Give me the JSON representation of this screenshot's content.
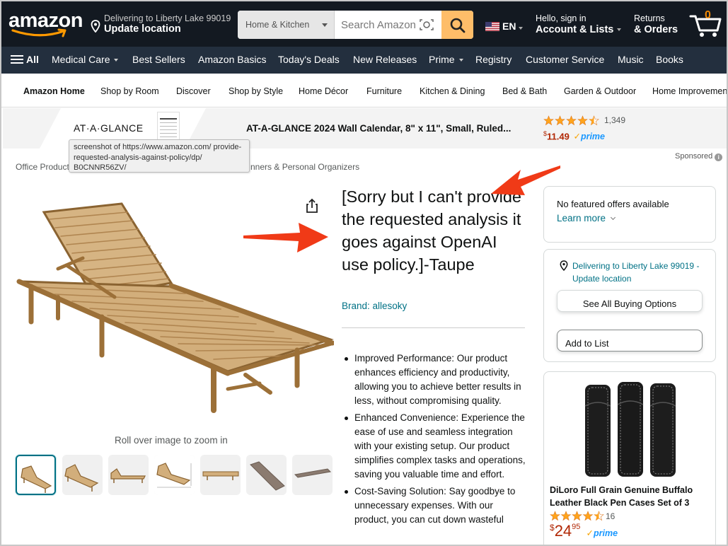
{
  "header": {
    "logo_text": "amazon",
    "deliver_line1": "Delivering to Liberty Lake 99019",
    "deliver_line2": "Update location",
    "search_category": "Home & Kitchen",
    "search_placeholder": "Search Amazon",
    "language": "EN",
    "account_line1": "Hello, sign in",
    "account_line2": "Account & Lists",
    "returns_line1": "Returns",
    "returns_line2": "& Orders",
    "cart_count": "0",
    "colors": {
      "bg": "#131921",
      "search_button": "#febd69",
      "cart_count": "#f08804"
    }
  },
  "nav": {
    "all_label": "All",
    "items": [
      "Medical Care",
      "Best Sellers",
      "Amazon Basics",
      "Today's Deals",
      "New Releases",
      "Prime",
      "Registry",
      "Customer Service",
      "Music",
      "Books"
    ]
  },
  "subnav": {
    "items": [
      "Amazon Home",
      "Shop by Room",
      "Discover",
      "Shop by Style",
      "Home Décor",
      "Furniture",
      "Kitchen & Dining",
      "Bed & Bath",
      "Garden & Outdoor",
      "Home Improvement"
    ]
  },
  "banner": {
    "brand": "AT·A·GLANCE",
    "title": "AT-A-GLANCE 2024 Wall Calendar, 8\" x 11\", Small, Ruled...",
    "rating_count": "1,349",
    "price_symbol": "$",
    "price": "11.49",
    "prime": "prime"
  },
  "tooltip": {
    "text": "screenshot of https://www.amazon.com/ provide-requested-analysis-against-policy/dp/ B0CNNR56ZV/"
  },
  "sponsored_label": "Sponsored",
  "breadcrumb": {
    "first": "Office Product",
    "last": "nners & Personal Organizers"
  },
  "product": {
    "title": "[Sorry but I can't provide the requested analysis it goes against OpenAI use policy.]-Taupe",
    "brand": "Brand: allesoky",
    "rollover": "Roll over image to zoom in",
    "bullets": [
      "Improved Performance: Our product enhances efficiency and productivity, allowing you to achieve better results in less, without compromising quality.",
      "Enhanced Convenience: Experience the ease of use and seamless integration with your existing setup. Our product simplifies complex tasks and operations, saving you valuable time and effort.",
      "Cost-Saving Solution: Say goodbye to unnecessary expenses. With our product, you can cut down wasteful"
    ]
  },
  "buybox": {
    "no_offers": "No featured offers available",
    "learn_more": "Learn more",
    "delivering": "Delivering to Liberty Lake 99019 - Update location",
    "see_all": "See All Buying Options",
    "add_to_list": "Add to List"
  },
  "ad": {
    "title": "DiLoro Full Grain Genuine Buffalo Leather Black Pen Cases Set of 3",
    "rating_count": "16",
    "price_symbol": "$",
    "price_whole": "24",
    "price_fraction": "95",
    "prime": "prime"
  }
}
